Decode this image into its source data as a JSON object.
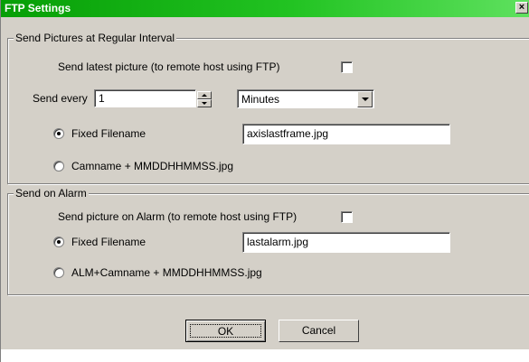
{
  "window": {
    "title": "FTP Settings",
    "close_label": "×"
  },
  "regular": {
    "group_title": "Send Pictures at Regular Interval",
    "send_latest_label": "Send latest picture (to remote host using FTP)",
    "send_latest_checked": false,
    "send_every_label": "Send every",
    "send_every_value": "1",
    "unit_selected": "Minutes",
    "fixed_filename_label": "Fixed Filename",
    "fixed_filename_value": "axislastframe.jpg",
    "fixed_filename_selected": true,
    "camname_label": "Camname + MMDDHHMMSS.jpg",
    "camname_selected": false
  },
  "alarm": {
    "group_title": "Send on Alarm",
    "send_alarm_label": "Send picture on Alarm (to remote host using FTP)",
    "send_alarm_checked": false,
    "fixed_filename_label": "Fixed Filename",
    "fixed_filename_value": "lastalarm.jpg",
    "fixed_filename_selected": true,
    "alm_label": "ALM+Camname + MMDDHHMMSS.jpg",
    "alm_selected": false
  },
  "buttons": {
    "ok_label": "OK",
    "cancel_label": "Cancel"
  }
}
